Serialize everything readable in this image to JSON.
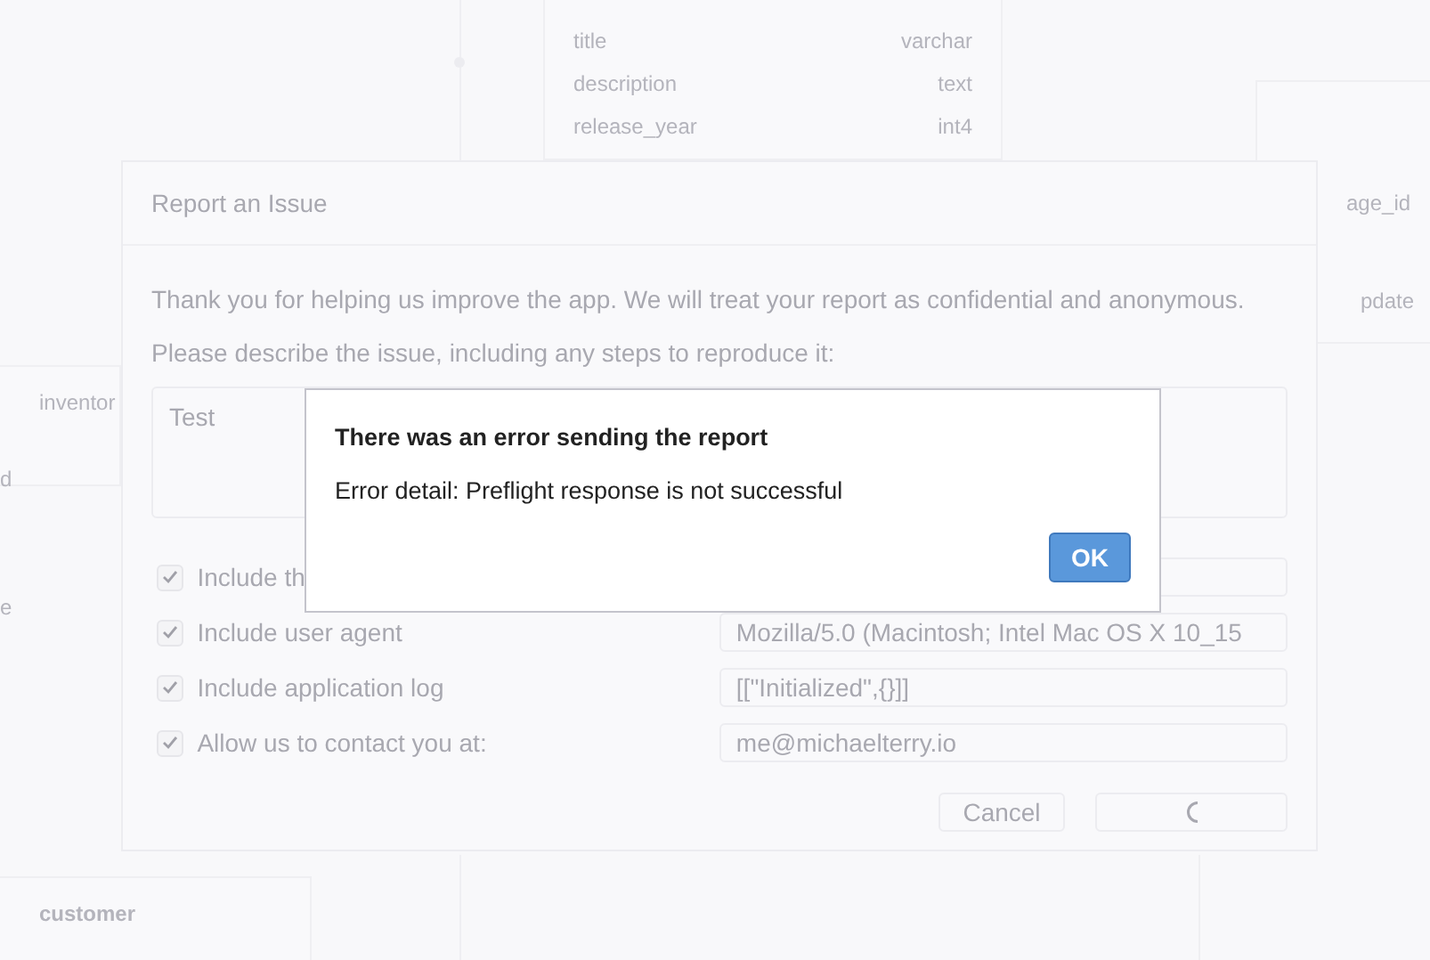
{
  "background": {
    "table_rows": [
      {
        "name": "title",
        "type": "varchar"
      },
      {
        "name": "description",
        "type": "text"
      },
      {
        "name": "release_year",
        "type": "int4"
      }
    ],
    "left_fragments": [
      "inventor",
      "d",
      "e"
    ],
    "bottom_label": "customer",
    "right_fragments": [
      "age_id",
      "pdate"
    ]
  },
  "report_dialog": {
    "title": "Report an Issue",
    "intro": "Thank you for helping us improve the app. We will treat your report as confidential and anonymous.",
    "prompt": "Please describe the issue, including any steps to reproduce it:",
    "description": "Test",
    "options": [
      {
        "label": "Include th",
        "checked": true
      },
      {
        "label": "Include user agent",
        "checked": true,
        "value": "Mozilla/5.0 (Macintosh; Intel Mac OS X 10_15"
      },
      {
        "label": "Include application log",
        "checked": true,
        "value": "[[\"Initialized\",{}]]"
      },
      {
        "label": "Allow us to contact you at:",
        "checked": true,
        "value": "me@michaelterry.io"
      }
    ],
    "cancel": "Cancel",
    "submitting": true
  },
  "error_dialog": {
    "title": "There was an error sending the report",
    "detail": "Error detail: Preflight response is not successful",
    "ok": "OK"
  }
}
